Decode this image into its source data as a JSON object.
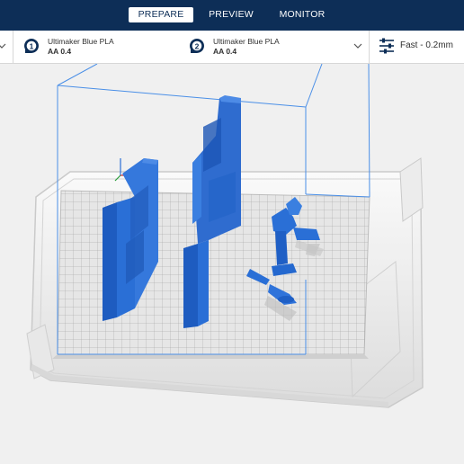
{
  "stages": {
    "prepare": "PREPARE",
    "preview": "PREVIEW",
    "monitor": "MONITOR",
    "active": "prepare"
  },
  "extruders": [
    {
      "number": "1",
      "material": "Ultimaker Blue PLA",
      "core": "AA 0.4"
    },
    {
      "number": "2",
      "material": "Ultimaker Blue PLA",
      "core": "AA 0.4"
    }
  ],
  "print_profile": {
    "label": "Fast - 0.2mm",
    "icon": "sliders-icon"
  },
  "colors": {
    "header": "#0d2e57",
    "model_blue": "#2a6fd6",
    "build_volume_line": "#4a8fe7"
  }
}
